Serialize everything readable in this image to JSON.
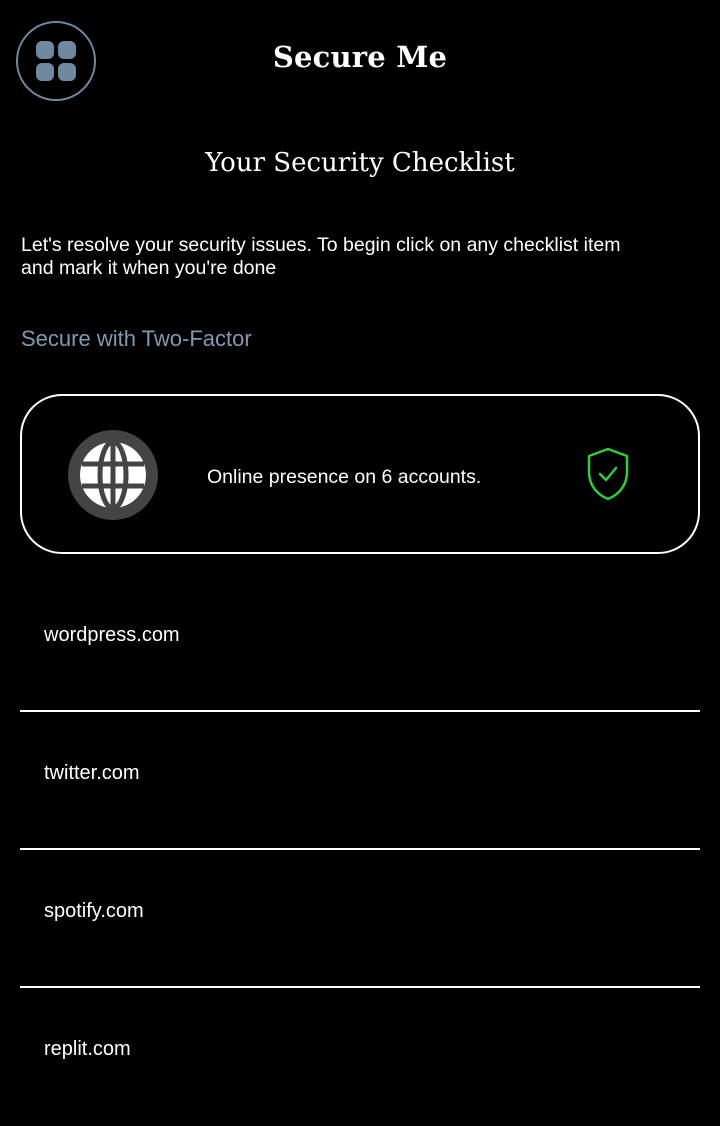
{
  "header": {
    "menu_icon": "grid-menu-icon",
    "app_title": "Secure Me"
  },
  "page": {
    "title": "Your Security Checklist",
    "intro_line_1": "Let's resolve your security issues. To begin click on any checklist item",
    "intro_line_2": "and mark it when you're done",
    "section_heading": "Secure with Two-Factor"
  },
  "summary": {
    "icon": "globe-icon",
    "text": "Online presence on 6 accounts.",
    "status_icon": "shield-check-icon",
    "status_color": "#2ecc40"
  },
  "accounts": [
    {
      "label": "wordpress.com"
    },
    {
      "label": "twitter.com"
    },
    {
      "label": "spotify.com"
    },
    {
      "label": "replit.com"
    }
  ],
  "colors": {
    "background": "#000000",
    "accent": "#7f9ab0",
    "text": "#ffffff"
  }
}
